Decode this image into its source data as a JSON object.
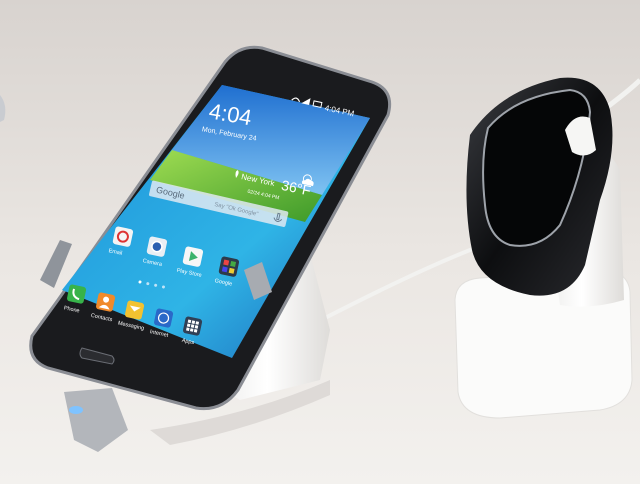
{
  "phone": {
    "status_time": "4:04 PM",
    "clock": "4:04",
    "date": "Mon, February 24",
    "weather": {
      "city": "New York",
      "temperature": "36°F",
      "updated": "02/24 4:04 PM"
    },
    "search": {
      "brand": "Google",
      "placeholder": "Say \"Ok Google\""
    },
    "apps_row1": [
      "Email",
      "Camera",
      "Play Store",
      "Google"
    ],
    "dock": [
      "Phone",
      "Contacts",
      "Messaging",
      "Internet",
      "Apps"
    ]
  },
  "colors": {
    "background": "#ebe7e3",
    "phone_body": "#1a1b1e",
    "screen_sky": "#2a7fd6",
    "grass": "#6cc43a",
    "stand": "#f6f6f4"
  },
  "icons": [
    "wifi-icon",
    "signal-icon",
    "battery-icon",
    "weather-sun-cloud-icon",
    "microphone-icon",
    "location-pin-icon"
  ]
}
